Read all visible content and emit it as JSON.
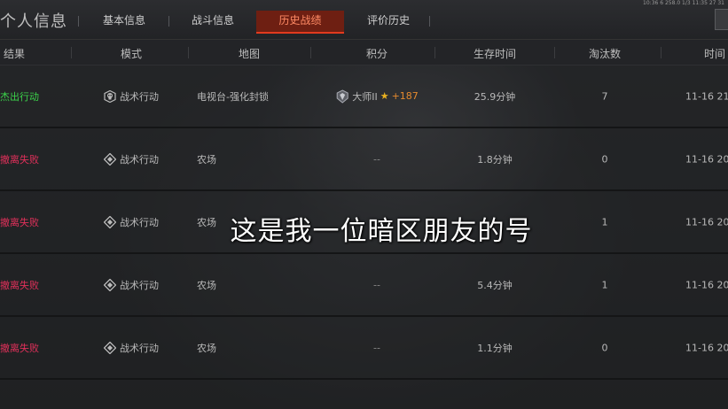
{
  "header": {
    "page_title": "个人信息",
    "tabs": [
      {
        "label": "基本信息",
        "active": false
      },
      {
        "label": "战斗信息",
        "active": false
      },
      {
        "label": "历史战绩",
        "active": true
      },
      {
        "label": "评价历史",
        "active": false
      }
    ],
    "status_text": "10:36 6 258.0 1/3 11:35 27 31"
  },
  "columns": [
    "结果",
    "模式",
    "地图",
    "积分",
    "生存时间",
    "淘汰数",
    "时间"
  ],
  "rows": [
    {
      "result": "杰出行动",
      "result_status": "win",
      "mode": "战术行动",
      "mode_icon": "skull-icon",
      "map": "电视台-强化封锁",
      "rank": "大师II",
      "score_delta": "+187",
      "survival": "25.9分钟",
      "kills": "7",
      "time": "11-16 21"
    },
    {
      "result": "撤离失败",
      "result_status": "fail",
      "mode": "战术行动",
      "mode_icon": "diamond-icon",
      "map": "农场",
      "rank": "",
      "score_delta": "--",
      "survival": "1.8分钟",
      "kills": "0",
      "time": "11-16 20"
    },
    {
      "result": "撤离失败",
      "result_status": "fail",
      "mode": "战术行动",
      "mode_icon": "diamond-icon",
      "map": "农场",
      "rank": "",
      "score_delta": "--",
      "survival": "",
      "kills": "1",
      "time": "11-16 20"
    },
    {
      "result": "撤离失败",
      "result_status": "fail",
      "mode": "战术行动",
      "mode_icon": "diamond-icon",
      "map": "农场",
      "rank": "",
      "score_delta": "--",
      "survival": "5.4分钟",
      "kills": "1",
      "time": "11-16 20"
    },
    {
      "result": "撤离失败",
      "result_status": "fail",
      "mode": "战术行动",
      "mode_icon": "diamond-icon",
      "map": "农场",
      "rank": "",
      "score_delta": "--",
      "survival": "1.1分钟",
      "kills": "0",
      "time": "11-16 20"
    }
  ],
  "overlay_subtitle": "这是我一位暗区朋友的号",
  "colors": {
    "active_tab": "#6e1f12",
    "active_tab_accent": "#e23a1e",
    "win": "#3bd24a",
    "fail": "#e0305a",
    "score_delta": "#e58a2e"
  }
}
